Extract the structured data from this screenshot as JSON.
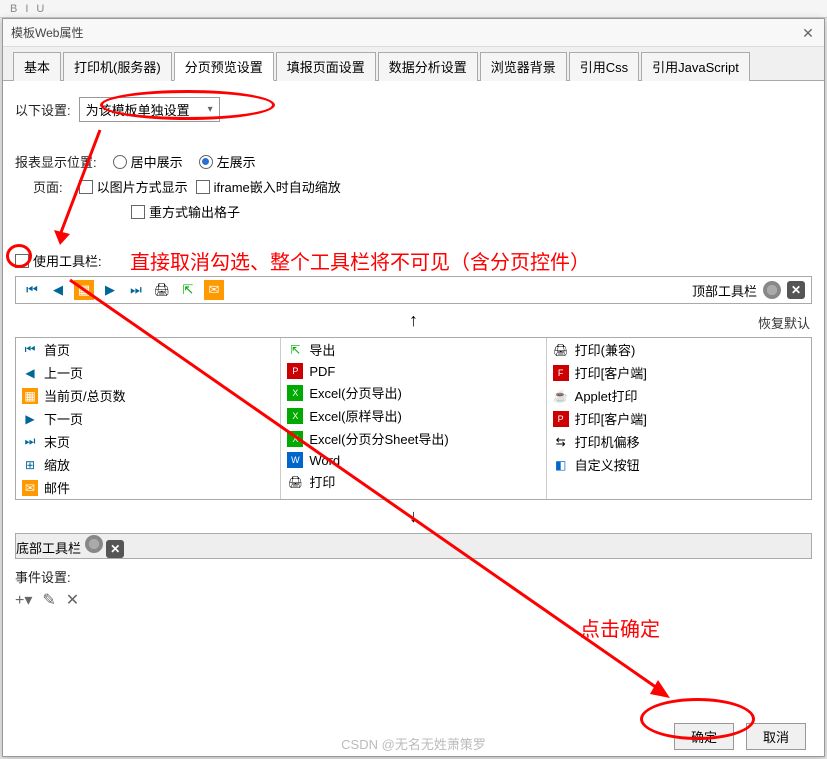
{
  "window": {
    "title": "模板Web属性"
  },
  "tabs": [
    "基本",
    "打印机(服务器)",
    "分页预览设置",
    "填报页面设置",
    "数据分析设置",
    "浏览器背景",
    "引用Css",
    "引用JavaScript"
  ],
  "settings": {
    "below_label": "以下设置:",
    "dropdown_value": "为该模板单独设置",
    "position_label": "报表显示位置:",
    "radio_center": "居中展示",
    "radio_left": "左展示",
    "page_label": "页面:",
    "chk_image": "以图片方式显示",
    "chk_iframe": "iframe嵌入时自动缩放",
    "chk_heavy": "重方式输出格子",
    "chk_toolbar": "使用工具栏:"
  },
  "annotations": {
    "text1": "直接取消勾选、整个工具栏将不可见（含分页控件）",
    "text2": "点击确定",
    "restore": "恢复默认"
  },
  "toolbar_strip": {
    "top_label": "顶部工具栏",
    "bottom_label": "底部工具栏"
  },
  "grid": {
    "col1": [
      "首页",
      "上一页",
      "当前页/总页数",
      "下一页",
      "末页",
      "缩放",
      "邮件"
    ],
    "col2": [
      "导出",
      "PDF",
      "Excel(分页导出)",
      "Excel(原样导出)",
      "Excel(分页分Sheet导出)",
      "Word",
      "打印"
    ],
    "col3": [
      "打印(兼容)",
      "打印[客户端]",
      "Applet打印",
      "打印[客户端]",
      "打印机偏移",
      "自定义按钮"
    ]
  },
  "events": {
    "label": "事件设置:"
  },
  "footer": {
    "ok": "确定",
    "cancel": "取消"
  },
  "watermark": "CSDN @无名无姓萧策罗"
}
